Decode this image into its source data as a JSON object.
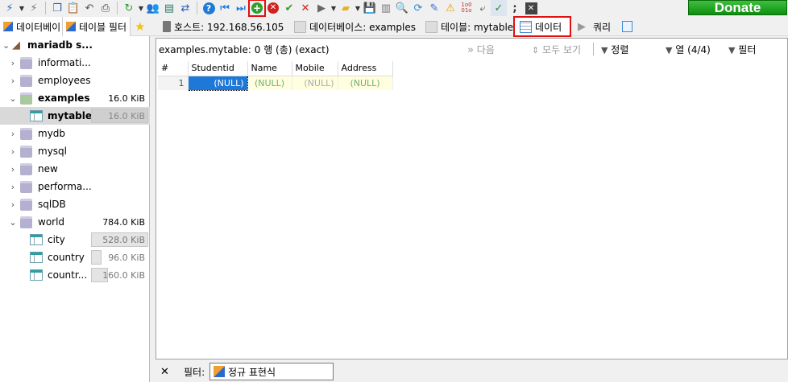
{
  "toolbar": {
    "items": [
      "connect-icon",
      "dropdown-arrow",
      "disconnect-icon",
      "copy-icon",
      "paste-icon",
      "undo-icon",
      "print-icon",
      "refresh-icon",
      "dropdown-arrow",
      "user-manager-icon",
      "export-icon",
      "transfer-icon",
      "help-icon",
      "first-record-icon",
      "last-record-icon",
      "add-row-icon",
      "delete-row-icon",
      "post-icon",
      "cancel-icon",
      "run-icon",
      "dropdown-arrow",
      "open-folder-icon",
      "save-icon",
      "save-as-icon",
      "find-icon",
      "replace-icon",
      "clear-icon",
      "warnings-icon",
      "binary-icon",
      "wrap-icon",
      "format-icon",
      "semicolon-icon",
      "close-tab-icon"
    ],
    "donate_label": "Donate"
  },
  "tabs": {
    "db_filter": "데이터베이",
    "table_filter": "테이블 필터",
    "host": "호스트: 192.168.56.105",
    "database": "데이터베이스: examples",
    "table": "테이블: mytable",
    "data": "데이터",
    "query": "쿼리"
  },
  "tree": {
    "server": "mariadb s...",
    "items": [
      {
        "label": "informati...",
        "size": ""
      },
      {
        "label": "employees",
        "size": ""
      },
      {
        "label": "examples",
        "size": "16.0 KiB"
      },
      {
        "label": "mytable",
        "size": "16.0 KiB"
      },
      {
        "label": "mydb",
        "size": ""
      },
      {
        "label": "mysql",
        "size": ""
      },
      {
        "label": "new",
        "size": ""
      },
      {
        "label": "performa...",
        "size": ""
      },
      {
        "label": "sqlDB",
        "size": ""
      },
      {
        "label": "world",
        "size": "784.0 KiB"
      },
      {
        "label": "city",
        "size": "528.0 KiB"
      },
      {
        "label": "country",
        "size": "96.0 KiB"
      },
      {
        "label": "countr...",
        "size": "160.0 KiB"
      }
    ]
  },
  "data_view": {
    "info": "examples.mytable: 0 행 (총) (exact)",
    "next": "다음",
    "show_all": "모두 보기",
    "sort": "정렬",
    "columns": "열 (4/4)",
    "filter": "필터"
  },
  "grid": {
    "headers": [
      "#",
      "Studentid",
      "Name",
      "Mobile",
      "Address"
    ],
    "row_number": "1",
    "cells": [
      "(NULL)",
      "(NULL)",
      "(NULL)",
      "(NULL)"
    ]
  },
  "bottom": {
    "close": "✕",
    "filter_label": "필터:",
    "regex_label": "정규 표현식"
  }
}
